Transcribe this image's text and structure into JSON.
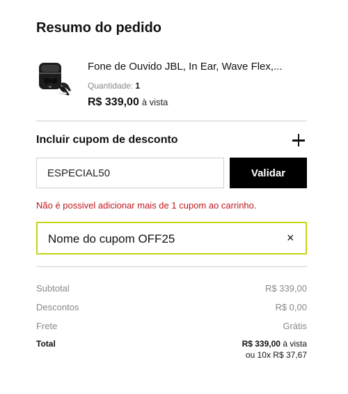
{
  "title": "Resumo do pedido",
  "product": {
    "name": "Fone de Ouvido JBL, In Ear, Wave Flex,...",
    "quantity_label": "Quantidade:",
    "quantity_value": "1",
    "price": "R$ 339,00",
    "price_condition": "à vista"
  },
  "coupon": {
    "title": "Incluir cupom de desconto",
    "input_value": "ESPECIAL50",
    "button_label": "Validar",
    "error_message": "Não é possivel adicionar mais de 1 cupom ao carrinho.",
    "applied_label": "Nome do cupom OFF25",
    "remove_symbol": "×",
    "applied_border_color": "#c6d416"
  },
  "summary": {
    "subtotal_label": "Subtotal",
    "subtotal_value": "R$ 339,00",
    "discount_label": "Descontos",
    "discount_value": "R$ 0,00",
    "shipping_label": "Frete",
    "shipping_value": "Grátis",
    "total_label": "Total",
    "total_value": "R$ 339,00",
    "total_condition": "à vista",
    "installments": "ou 10x R$ 37,67"
  },
  "colors": {
    "error": "#c0161c",
    "button_bg": "#000000"
  }
}
